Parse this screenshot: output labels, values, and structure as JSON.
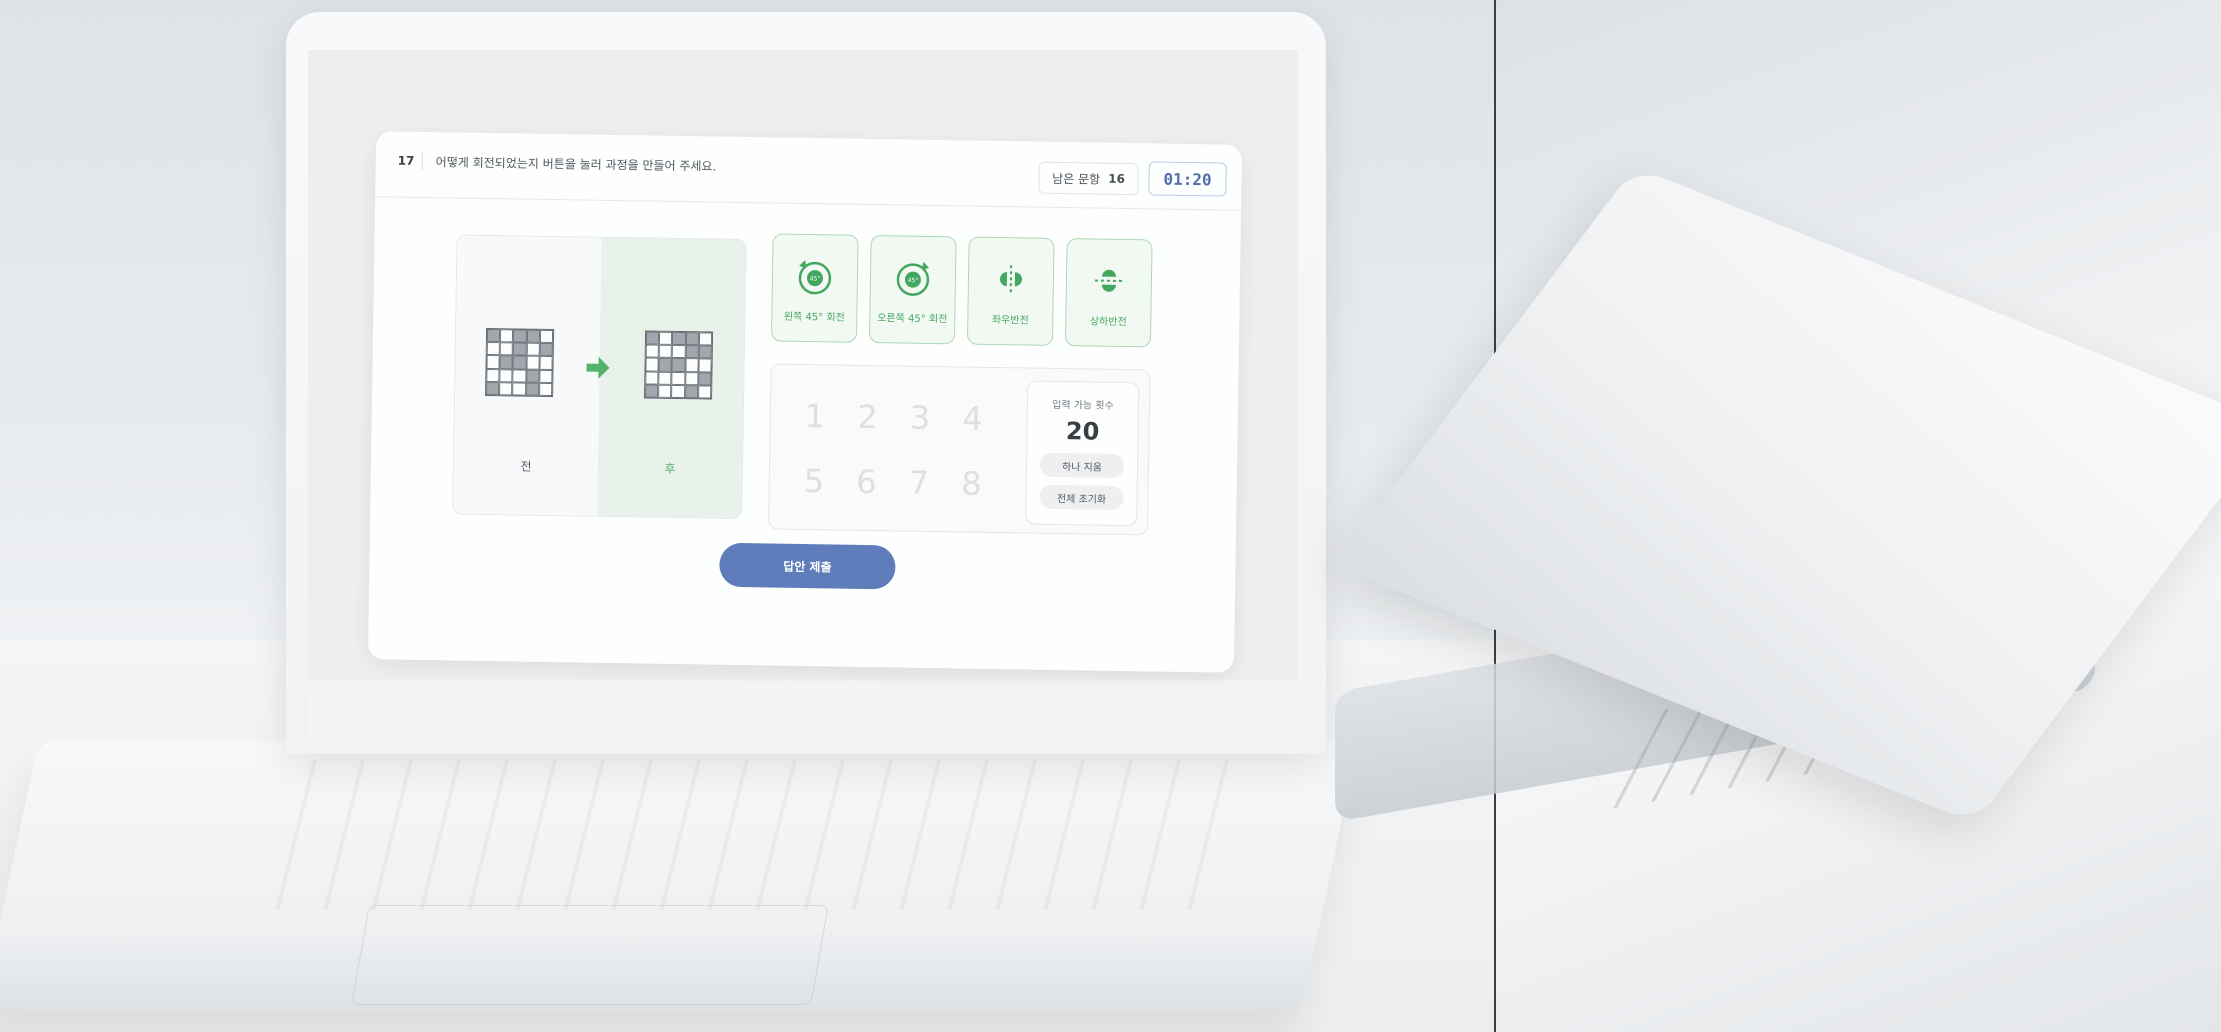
{
  "question": {
    "number": "17",
    "text": "어떻게 회전되었는지 버튼을 눌러 과정을 만들어 주세요."
  },
  "header": {
    "remaining_label": "남은 문항",
    "remaining_count": "16",
    "timer": "01:20"
  },
  "before_panel": {
    "label": "전",
    "grid": [
      [
        1,
        0,
        1,
        1,
        0
      ],
      [
        0,
        0,
        1,
        0,
        1
      ],
      [
        0,
        1,
        1,
        0,
        0
      ],
      [
        0,
        0,
        0,
        1,
        0
      ],
      [
        1,
        0,
        0,
        1,
        0
      ]
    ]
  },
  "after_panel": {
    "label": "후",
    "grid": [
      [
        1,
        0,
        1,
        1,
        0
      ],
      [
        0,
        0,
        0,
        1,
        1
      ],
      [
        0,
        1,
        1,
        0,
        0
      ],
      [
        0,
        0,
        0,
        0,
        1
      ],
      [
        1,
        0,
        0,
        1,
        0
      ]
    ]
  },
  "tools": [
    {
      "label": "왼쪽 45° 회전",
      "icon": "rotate-left-45-icon",
      "badge": "45°"
    },
    {
      "label": "오른쪽 45° 회전",
      "icon": "rotate-right-45-icon",
      "badge": "45°"
    },
    {
      "label": "좌우반전",
      "icon": "flip-horizontal-icon"
    },
    {
      "label": "상하반전",
      "icon": "flip-vertical-icon"
    }
  ],
  "keypad": {
    "numbers": [
      "1",
      "2",
      "3",
      "4",
      "5",
      "6",
      "7",
      "8"
    ]
  },
  "input_count": {
    "label": "입력 가능 횟수",
    "value": "20",
    "undo_label": "하나 지움",
    "reset_label": "전체 초기화"
  },
  "submit_label": "답안 제출",
  "colors": {
    "accent_green": "#3aa356",
    "accent_blue": "#5876b8",
    "timer_blue": "#4a66a8"
  }
}
